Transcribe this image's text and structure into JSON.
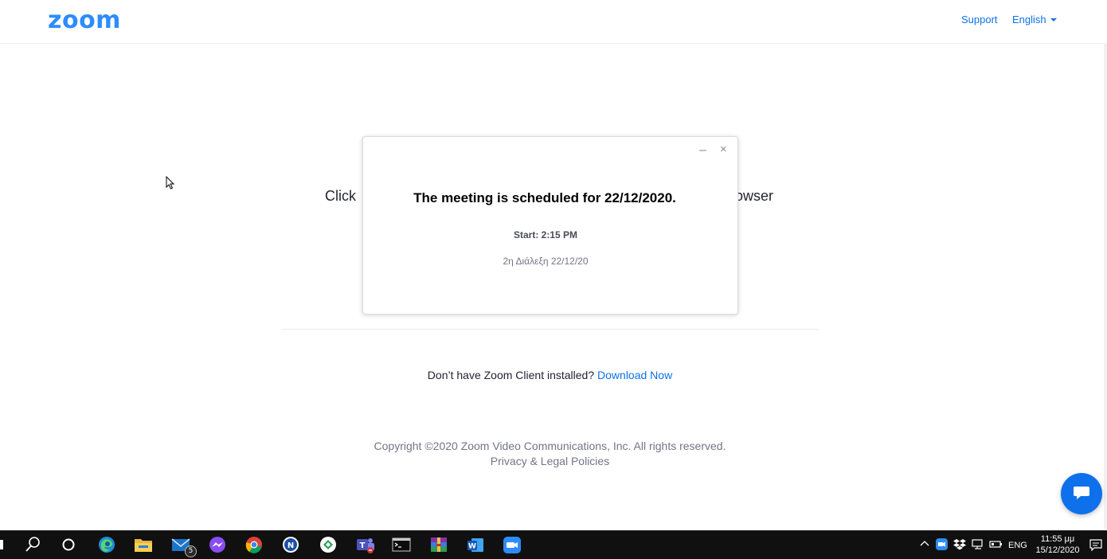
{
  "header": {
    "logo": "zoom",
    "support_label": "Support",
    "language_label": "English"
  },
  "background": {
    "prompt_left": "Click",
    "prompt_right": "owser",
    "download_question": "Don’t have Zoom Client installed?",
    "download_link": "Download Now",
    "copyright": "Copyright ©2020 Zoom Video Communications, Inc. All rights reserved.",
    "privacy_link": "Privacy & Legal Policies"
  },
  "modal": {
    "title": "The meeting is scheduled for 22/12/2020.",
    "start": "Start: 2:15 PM",
    "topic": "2η Διάλεξη 22/12/20",
    "minimize_glyph": "–",
    "close_glyph": "×"
  },
  "taskbar": {
    "mail_badge": "5",
    "language": "ENG",
    "time": "11:55 μμ",
    "date": "15/12/2020",
    "icons": [
      "windows-start-icon",
      "search-icon",
      "cortana-icon",
      "edge-icon",
      "file-explorer-icon",
      "mail-icon",
      "messenger-icon",
      "chrome-icon",
      "app-icon",
      "app-icon-2",
      "teams-icon",
      "terminal-icon",
      "winrar-icon",
      "word-icon",
      "zoom-icon"
    ]
  },
  "colors": {
    "brand": "#2D8CFF",
    "link": "#0E71EB",
    "taskbar": "#101010"
  }
}
